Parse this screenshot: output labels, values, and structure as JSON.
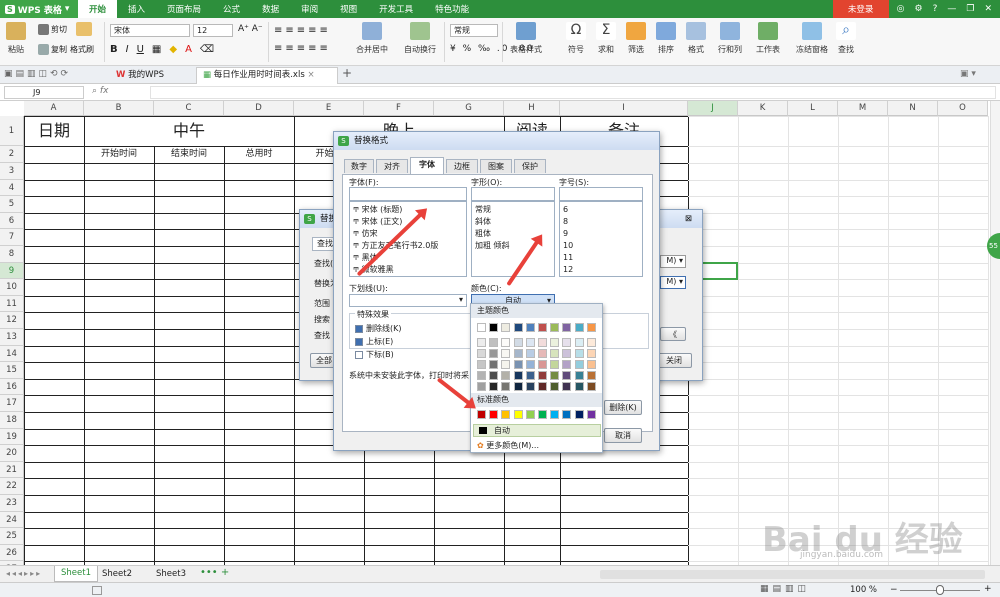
{
  "app": {
    "name": "WPS 表格",
    "login": "未登录"
  },
  "menu_tabs": [
    "开始",
    "插入",
    "页面布局",
    "公式",
    "数据",
    "审阅",
    "视图",
    "开发工具",
    "特色功能"
  ],
  "ribbon": {
    "paste": "粘贴",
    "cut": "剪切",
    "copy": "复制",
    "format_painter": "格式刷",
    "font": "宋体",
    "size": "12",
    "bold": "B",
    "italic": "I",
    "underline": "U",
    "merge": "合并居中",
    "wrap": "自动换行",
    "number_format": "常规",
    "table_style": "表格样式",
    "symbol": "符号",
    "sum": "求和",
    "filter": "筛选",
    "sort": "排序",
    "format": "格式",
    "row_col": "行和列",
    "worksheet": "工作表",
    "freeze": "冻结窗格",
    "find": "查找"
  },
  "doc_tabs": {
    "tab1": "我的WPS",
    "tab2": "每日作业用时时间表.xls"
  },
  "formula": {
    "cell_ref": "J9",
    "fx": "fx"
  },
  "columns": [
    "A",
    "B",
    "C",
    "D",
    "E",
    "F",
    "G",
    "H",
    "I",
    "J",
    "K",
    "L",
    "M",
    "N",
    "O"
  ],
  "rows": [
    "1",
    "2",
    "3",
    "4",
    "5",
    "6",
    "7",
    "8",
    "9",
    "10",
    "11",
    "12",
    "13",
    "14",
    "15",
    "16",
    "17",
    "18",
    "19",
    "20",
    "21",
    "22",
    "23",
    "24",
    "25",
    "26",
    "27"
  ],
  "sheet_text": {
    "a1": "日期",
    "c1": "中午",
    "f1": "晚上",
    "h1": "阅读",
    "i1": "备注",
    "b2": "开始时间",
    "c2": "结束时间",
    "d2": "总用时",
    "e2": "开始时"
  },
  "sheets": [
    "Sheet1",
    "Sheet2",
    "Sheet3"
  ],
  "status": {
    "zoom": "100 %"
  },
  "find_dialog": {
    "title": "替换",
    "tab": "查找",
    "labels": [
      "查找(",
      "替换为",
      "范围",
      "搜索",
      "查找"
    ],
    "btn_all": "全部",
    "btn_close": "关闭",
    "btn_more": "《"
  },
  "format_dialog": {
    "title": "替换格式",
    "tabs": [
      "数字",
      "对齐",
      "字体",
      "边框",
      "图案",
      "保护"
    ],
    "font_label": "字体(F):",
    "style_label": "字形(O):",
    "size_label": "字号(S):",
    "fonts": [
      "宋体 (标题)",
      "宋体 (正文)",
      "仿宋",
      "方正友毛笔行书2.0版",
      "黑体",
      "微软雅黑"
    ],
    "styles": [
      "常规",
      "斜体",
      "粗体",
      "加粗 倾斜"
    ],
    "sizes": [
      "6",
      "8",
      "9",
      "10",
      "11",
      "12"
    ],
    "underline_label": "下划线(U):",
    "color_label": "颜色(C):",
    "color_value": "自动",
    "effects_title": "特殊效果",
    "effects": [
      "删除线(K)",
      "上标(E)",
      "下标(B)"
    ],
    "note": "系统中未安装此字体，打印时将采",
    "btn_delete": "删除(K)",
    "btn_cancel": "取消"
  },
  "color_popup": {
    "theme_title": "主题颜色",
    "std_title": "标准颜色",
    "auto": "自动",
    "more": "更多颜色(M)..."
  },
  "colors": {
    "theme_top": [
      "#ffffff",
      "#000000",
      "#eeece1",
      "#1f497d",
      "#4f81bd",
      "#c0504d",
      "#9bbb59",
      "#8064a2",
      "#4bacc6",
      "#f79646"
    ],
    "standard": [
      "#c00000",
      "#ff0000",
      "#ffc000",
      "#ffff00",
      "#92d050",
      "#00b050",
      "#00b0f0",
      "#0070c0",
      "#002060",
      "#7030a0"
    ],
    "accent": "#2d8f3c",
    "arrow": "#e8413a"
  },
  "watermark": "Bai du 经验",
  "watermark_url": "jingyan.baidu.com"
}
